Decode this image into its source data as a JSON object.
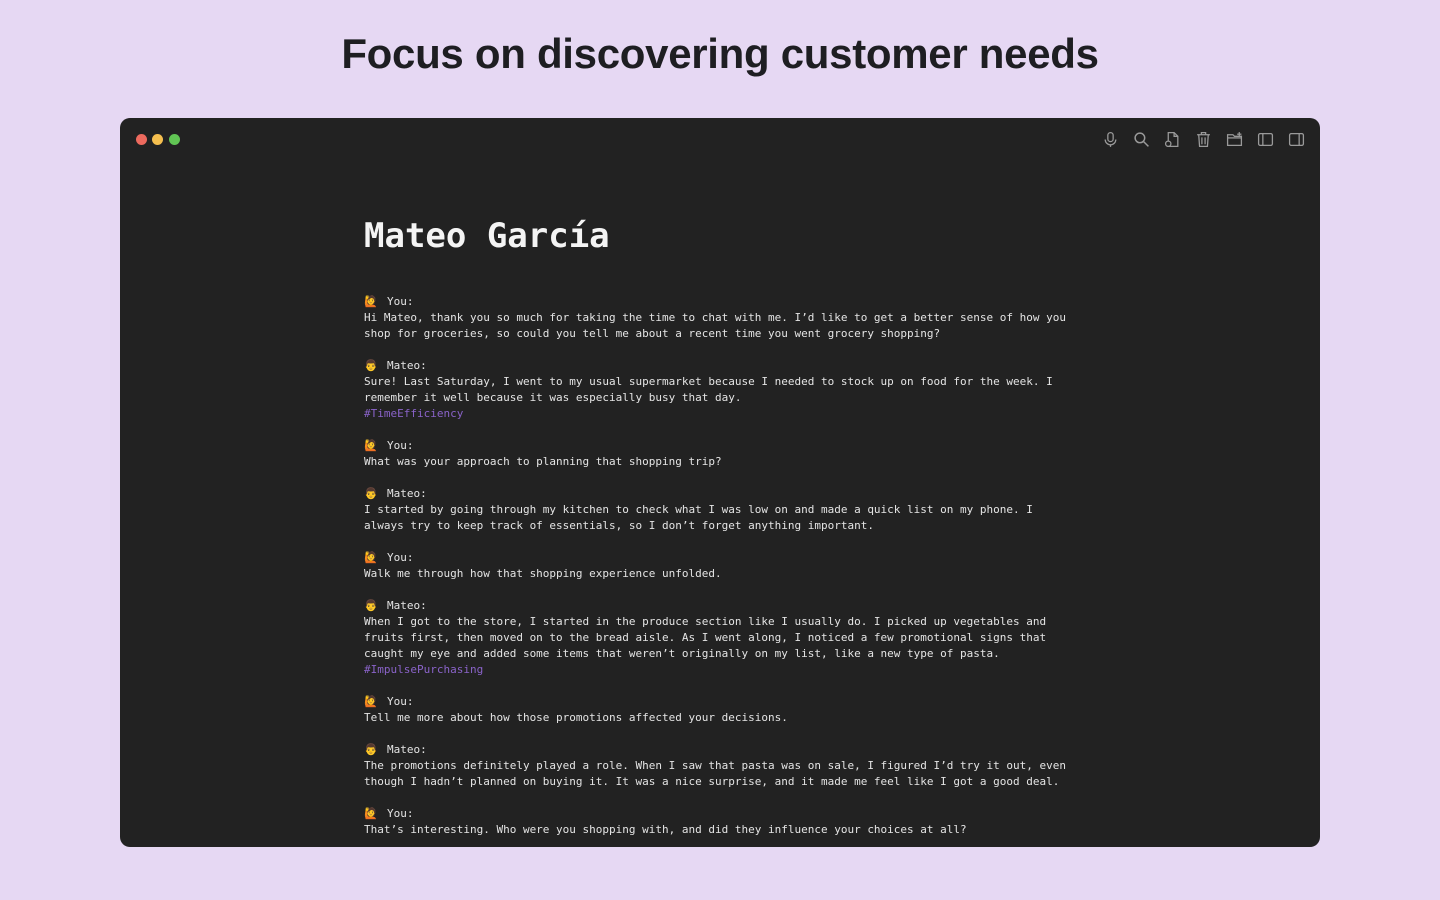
{
  "headline": "Focus on discovering customer needs",
  "colors": {
    "background": "#e6d8f3",
    "window": "#222222",
    "tag": "#8a63c9",
    "close": "#ed6a5e",
    "minimize": "#f5bf4f",
    "zoom": "#61c554"
  },
  "toolbar": {
    "icons": [
      "microphone-icon",
      "search-icon",
      "file-link-icon",
      "trash-icon",
      "folder-add-icon",
      "left-sidebar-icon",
      "right-sidebar-icon"
    ]
  },
  "document": {
    "title": "Mateo García",
    "turns": [
      {
        "avatar": "🙋",
        "speaker": "You:",
        "text": "Hi Mateo, thank you so much for taking the time to chat with me. I’d like to get a better sense of how you\nshop for groceries, so could you tell me about a recent time you went grocery shopping?",
        "tag": ""
      },
      {
        "avatar": "👨",
        "speaker": "Mateo:",
        "text": "Sure! Last Saturday, I went to my usual supermarket because I needed to stock up on food for the week. I\nremember it well because it was especially busy that day.",
        "tag": "#TimeEfficiency"
      },
      {
        "avatar": "🙋",
        "speaker": "You:",
        "text": "What was your approach to planning that shopping trip?",
        "tag": ""
      },
      {
        "avatar": "👨",
        "speaker": "Mateo:",
        "text": "I started by going through my kitchen to check what I was low on and made a quick list on my phone. I\nalways try to keep track of essentials, so I don’t forget anything important.",
        "tag": ""
      },
      {
        "avatar": "🙋",
        "speaker": "You:",
        "text": "Walk me through how that shopping experience unfolded.",
        "tag": ""
      },
      {
        "avatar": "👨",
        "speaker": "Mateo:",
        "text": "When I got to the store, I started in the produce section like I usually do. I picked up vegetables and\nfruits first, then moved on to the bread aisle. As I went along, I noticed a few promotional signs that\ncaught my eye and added some items that weren’t originally on my list, like a new type of pasta.",
        "tag": "#ImpulsePurchasing"
      },
      {
        "avatar": "🙋",
        "speaker": "You:",
        "text": "Tell me more about how those promotions affected your decisions.",
        "tag": ""
      },
      {
        "avatar": "👨",
        "speaker": "Mateo:",
        "text": "The promotions definitely played a role. When I saw that pasta was on sale, I figured I’d try it out, even\nthough I hadn’t planned on buying it. It was a nice surprise, and it made me feel like I got a good deal.",
        "tag": ""
      },
      {
        "avatar": "🙋",
        "speaker": "You:",
        "text": "That’s interesting. Who were you shopping with, and did they influence your choices at all?",
        "tag": ""
      }
    ]
  }
}
